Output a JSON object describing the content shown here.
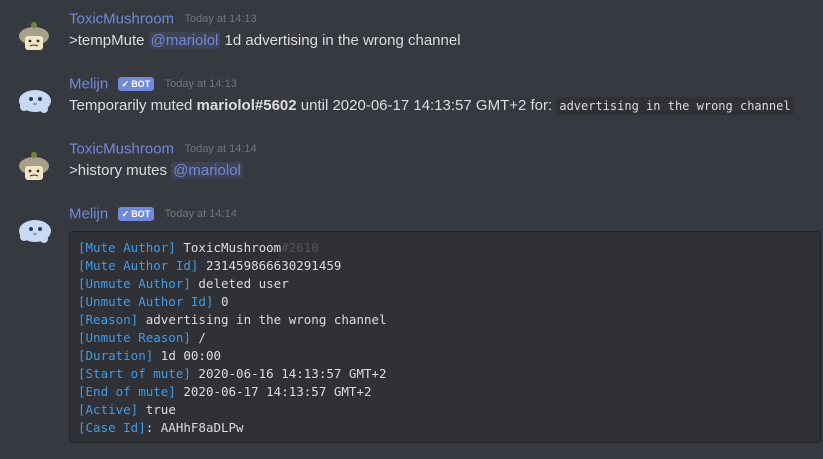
{
  "colors": {
    "background": "#36393f",
    "username": "#7289da",
    "bot_tag": "#7289da",
    "timestamp": "#72767d",
    "text": "#dcddde",
    "code_bg": "#2f3136",
    "code_key": "#3e9ce6"
  },
  "icons": {
    "toxic_avatar": "mushroom-avatar-icon",
    "melijn_avatar": "blue-blob-avatar-icon",
    "bot_check": "checkmark-icon"
  },
  "messages": [
    {
      "author": "ToxicMushroom",
      "timestamp": "Today at 14:13",
      "prefix": ">tempMute ",
      "mention": "@mariolol",
      "suffix": " 1d advertising in the wrong channel"
    },
    {
      "author": "Melijn",
      "bot_label": "BOT",
      "bot_check": "✓",
      "timestamp": "Today at 14:13",
      "text_before": "Temporarily muted ",
      "bold_user": "mariolol#5602",
      "text_middle": " until 2020-06-17 14:13:57 GMT+2 for: ",
      "code": "advertising in the wrong channel"
    },
    {
      "author": "ToxicMushroom",
      "timestamp": "Today at 14:14",
      "prefix": ">history mutes ",
      "mention": "@mariolol"
    },
    {
      "author": "Melijn",
      "bot_label": "BOT",
      "bot_check": "✓",
      "timestamp": "Today at 14:14",
      "codeblock": {
        "lines": [
          {
            "key": "[Mute Author]",
            "value": " ToxicMushroom",
            "dim": "#2610"
          },
          {
            "key": "[Mute Author Id]",
            "value": " 231459866630291459"
          },
          {
            "key": "[Unmute Author]",
            "value": " deleted user"
          },
          {
            "key": "[Unmute Author Id]",
            "value": " 0"
          },
          {
            "key": "[Reason]",
            "value": " advertising in the wrong channel"
          },
          {
            "key": "[Unmute Reason]",
            "value": " /"
          },
          {
            "key": "[Duration]",
            "value": " 1d 00:00"
          },
          {
            "key": "[Start of mute]",
            "value": " 2020-06-16 14:13:57 GMT+2"
          },
          {
            "key": "[End of mute]",
            "value": " 2020-06-17 14:13:57 GMT+2"
          },
          {
            "key": "[Active]",
            "value": " true"
          },
          {
            "key": "[Case Id]",
            "value": ": AAHhF8aDLPw"
          }
        ]
      }
    }
  ]
}
